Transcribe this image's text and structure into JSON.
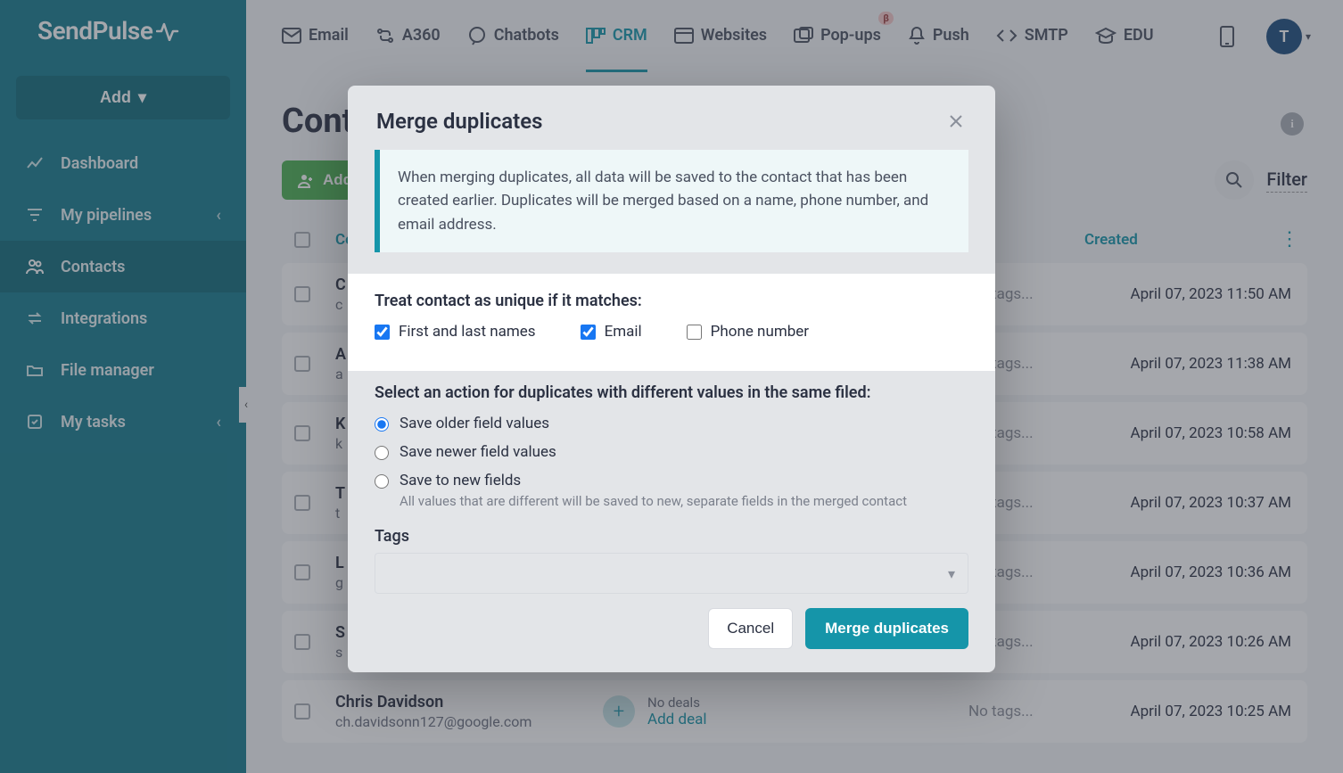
{
  "brand": "SendPulse",
  "sidebar": {
    "add_label": "Add",
    "items": [
      {
        "label": "Dashboard"
      },
      {
        "label": "My pipelines"
      },
      {
        "label": "Contacts"
      },
      {
        "label": "Integrations"
      },
      {
        "label": "File manager"
      },
      {
        "label": "My tasks"
      }
    ]
  },
  "topbar": {
    "items": [
      {
        "label": "Email"
      },
      {
        "label": "A360"
      },
      {
        "label": "Chatbots"
      },
      {
        "label": "CRM"
      },
      {
        "label": "Websites"
      },
      {
        "label": "Pop-ups",
        "badge": "β"
      },
      {
        "label": "Push"
      },
      {
        "label": "SMTP"
      },
      {
        "label": "EDU"
      }
    ],
    "avatar_initial": "T"
  },
  "page": {
    "title": "Contacts",
    "add_contact_label": "Add contact",
    "filter_label": "Filter",
    "columns": {
      "contact": "Contact",
      "created": "Created"
    },
    "no_deals": "No deals",
    "add_deal": "Add deal",
    "no_tags": "No tags...",
    "rows": [
      {
        "name": "C",
        "sub": "c",
        "created": "April 07, 2023 11:50 AM"
      },
      {
        "name": "A",
        "sub": "a",
        "created": "April 07, 2023 11:38 AM"
      },
      {
        "name": "K",
        "sub": "k",
        "created": "April 07, 2023 10:58 AM"
      },
      {
        "name": "T",
        "sub": "t",
        "created": "April 07, 2023 10:37 AM"
      },
      {
        "name": "L",
        "sub": "g",
        "created": "April 07, 2023 10:36 AM"
      },
      {
        "name": "S",
        "sub": "s",
        "created": "April 07, 2023 10:26 AM"
      },
      {
        "name": "Chris Davidson",
        "sub": "ch.davidsonn127@google.com",
        "created": "April 07, 2023 10:25 AM"
      }
    ]
  },
  "modal": {
    "title": "Merge duplicates",
    "info": "When merging duplicates, all data will be saved to the contact that has been created earlier. Duplicates will be merged based on a name, phone number, and email address.",
    "unique_head": "Treat contact as unique if it matches:",
    "chk_names": "First and last names",
    "chk_email": "Email",
    "chk_phone": "Phone number",
    "action_head": "Select an action for duplicates with different values in the same filed:",
    "r_older": "Save older field values",
    "r_newer": "Save newer field values",
    "r_new": "Save to new fields",
    "r_new_desc": "All values that are different will be saved to new, separate fields in the merged contact",
    "tags_label": "Tags",
    "cancel": "Cancel",
    "merge": "Merge duplicates"
  }
}
